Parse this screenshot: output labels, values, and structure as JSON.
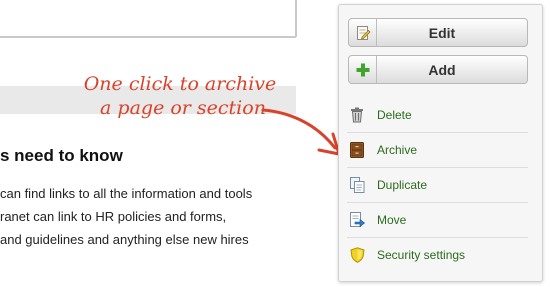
{
  "page": {
    "heading": "s need to know",
    "lines": [
      "can find links to all the information and tools",
      "ranet can link to HR policies and forms,",
      "and guidelines and anything else new hires"
    ]
  },
  "annotation": {
    "line1": "One click to archive",
    "line2": "a page or section"
  },
  "menu": {
    "edit_label": "Edit",
    "add_label": "Add",
    "items": [
      {
        "label": "Delete",
        "icon": "trash-icon"
      },
      {
        "label": "Archive",
        "icon": "archive-icon"
      },
      {
        "label": "Duplicate",
        "icon": "duplicate-icon"
      },
      {
        "label": "Move",
        "icon": "move-icon"
      },
      {
        "label": "Security settings",
        "icon": "shield-icon"
      }
    ]
  },
  "colors": {
    "annotation": "#d8432b",
    "menu_link": "#2c6b1d",
    "add_plus": "#3fa52c"
  }
}
